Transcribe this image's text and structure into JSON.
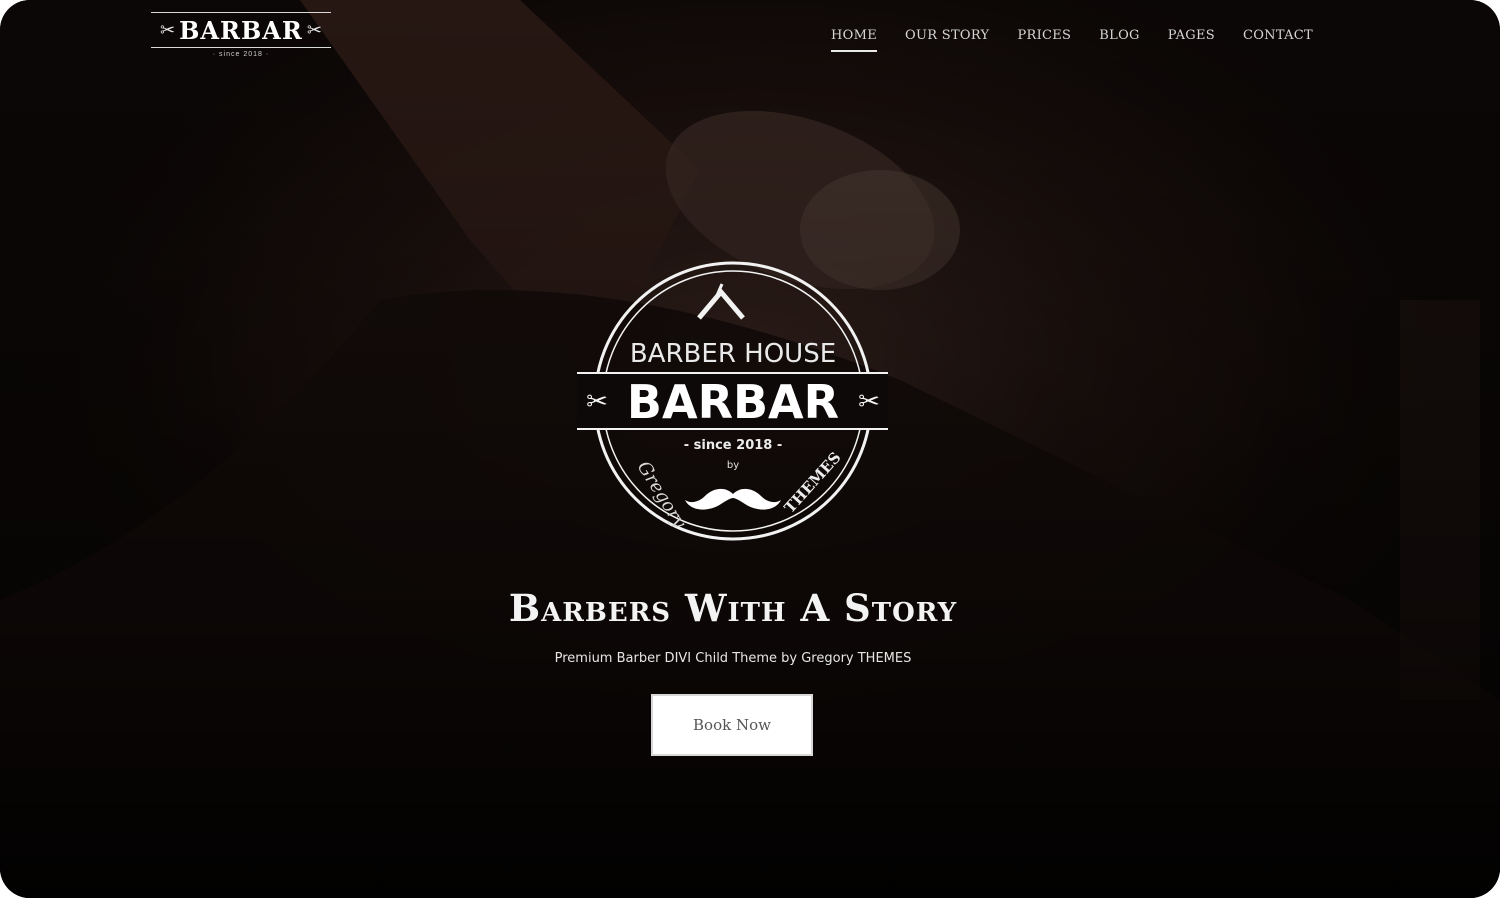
{
  "brand": {
    "name": "BARBAR",
    "since": "· since 2018 ·"
  },
  "nav": {
    "items": [
      {
        "label": "HOME",
        "active": true
      },
      {
        "label": "OUR STORY",
        "active": false
      },
      {
        "label": "PRICES",
        "active": false
      },
      {
        "label": "BLOG",
        "active": false
      },
      {
        "label": "PAGES",
        "active": false
      },
      {
        "label": "CONTACT",
        "active": false
      }
    ]
  },
  "emblem": {
    "top_text": "BARBER HOUSE",
    "name": "BARBAR",
    "since": "- since 2018 -",
    "by": "by",
    "left_script": "Gregory",
    "right_text": "THEMES"
  },
  "hero": {
    "title": "Barbers With A Story",
    "subtitle": "Premium Barber DIVI Child Theme by Gregory THEMES",
    "cta_label": "Book Now"
  },
  "colors": {
    "background": "#0a0605",
    "text": "#f3f3f3",
    "button_bg": "#ffffff"
  }
}
